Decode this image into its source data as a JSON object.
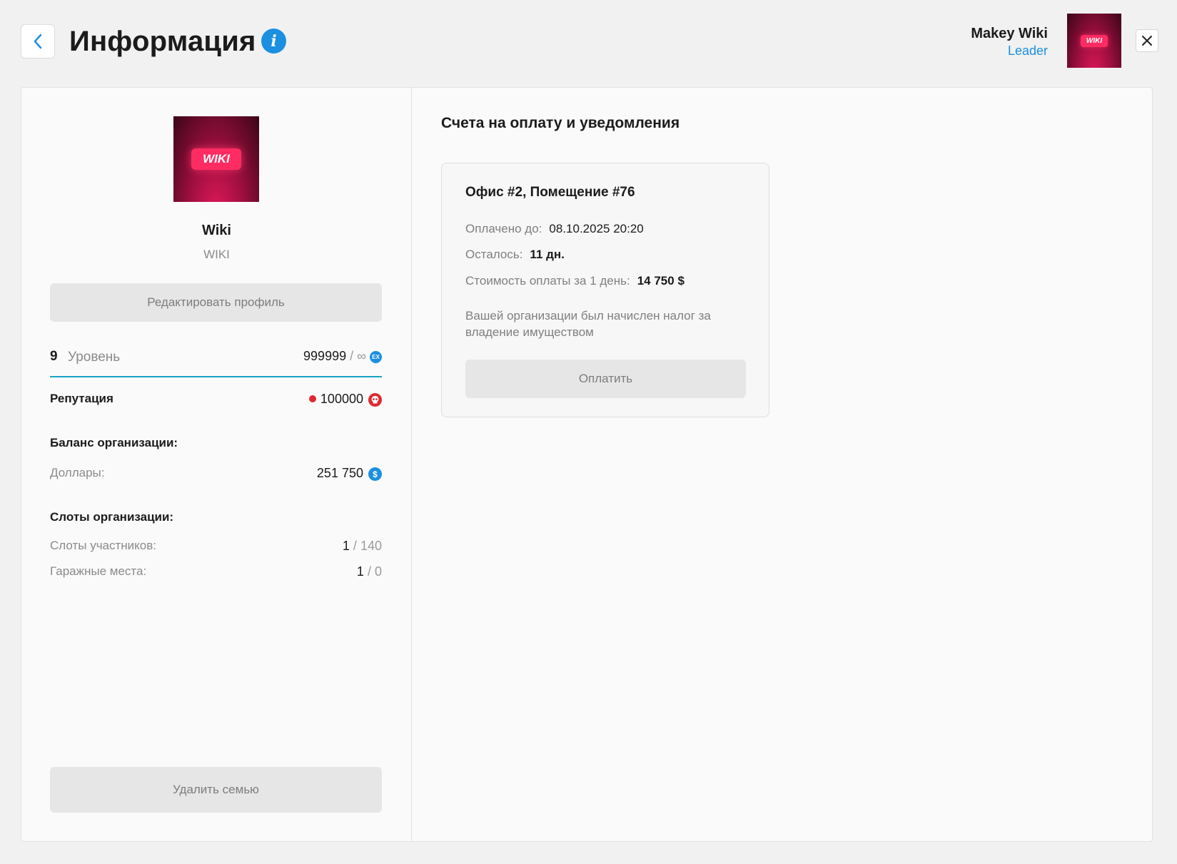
{
  "header": {
    "title": "Информация",
    "user_name": "Makey Wiki",
    "user_role": "Leader",
    "avatar_badge": "WIKI"
  },
  "profile": {
    "badge": "WIKI",
    "name": "Wiki",
    "tag": "WIKI",
    "edit_label": "Редактировать профиль",
    "level_number": "9",
    "level_label": "Уровень",
    "level_exp": "999999",
    "level_exp_sep": "/",
    "level_max": "∞",
    "level_icon": "EX",
    "reputation_label": "Репутация",
    "reputation_value": "100000",
    "balance_heading": "Баланс организации:",
    "dollars_label": "Доллары:",
    "dollars_value": "251 750",
    "dollar_icon": "$",
    "slots_heading": "Слоты организации:",
    "member_slots_label": "Слоты участников:",
    "member_slots_used": "1",
    "member_slots_sep": "/",
    "member_slots_total": "140",
    "garage_label": "Гаражные места:",
    "garage_used": "1",
    "garage_sep": "/",
    "garage_total": "0",
    "delete_label": "Удалить семью"
  },
  "bills": {
    "title": "Счета на оплату и уведомления",
    "card": {
      "title": "Офис #2, Помещение #76",
      "paid_until_label": "Оплачено до:",
      "paid_until_value": "08.10.2025 20:20",
      "remaining_label": "Осталось:",
      "remaining_value": "11 дн.",
      "cost_label": "Стоимость оплаты за 1 день:",
      "cost_value": "14 750 $",
      "note": "Вашей организации был начислен налог за владение имуществом",
      "pay_label": "Оплатить"
    }
  },
  "colors": {
    "accent": "#1b8fe0",
    "level_bar": "#1aa3c8",
    "reputation": "#e0282f",
    "badge": "#ff2b63"
  }
}
